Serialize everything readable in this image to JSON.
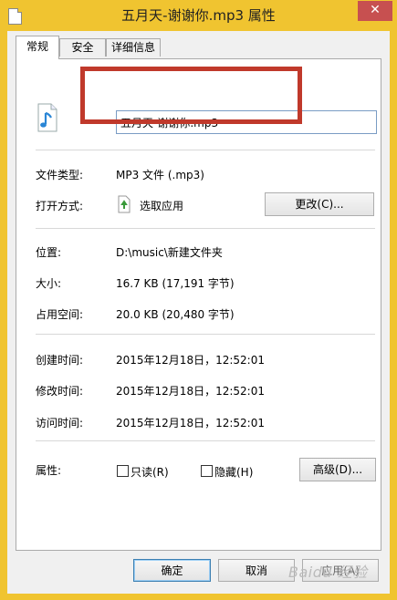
{
  "window": {
    "title": "五月天-谢谢你.mp3 属性",
    "close_glyph": "✕"
  },
  "tabs": [
    {
      "label": "常规",
      "active": true
    },
    {
      "label": "安全",
      "active": false
    },
    {
      "label": "详细信息",
      "active": false
    }
  ],
  "file": {
    "name": "五月天-谢谢你.mp3",
    "icon": "music-note-icon"
  },
  "general": {
    "file_type_label": "文件类型:",
    "file_type_value": "MP3 文件 (.mp3)",
    "open_with_label": "打开方式:",
    "open_with_value": "选取应用",
    "change_button": "更改(C)..."
  },
  "location": {
    "location_label": "位置:",
    "location_value": "D:\\music\\新建文件夹",
    "size_label": "大小:",
    "size_value": "16.7 KB (17,191 字节)",
    "size_on_disk_label": "占用空间:",
    "size_on_disk_value": "20.0 KB (20,480 字节)"
  },
  "times": {
    "created_label": "创建时间:",
    "created_value": "2015年12月18日，12:52:01",
    "modified_label": "修改时间:",
    "modified_value": "2015年12月18日，12:52:01",
    "accessed_label": "访问时间:",
    "accessed_value": "2015年12月18日，12:52:01"
  },
  "attributes": {
    "label": "属性:",
    "readonly_label": "只读(R)",
    "readonly_checked": false,
    "hidden_label": "隐藏(H)",
    "hidden_checked": false,
    "advanced_button": "高级(D)..."
  },
  "footer": {
    "ok": "确定",
    "cancel": "取消",
    "apply": "应用(A)"
  },
  "watermark": "Baidu 经验",
  "colors": {
    "title_bar": "#f0c430",
    "highlight": "#c0392b",
    "close": "#c75050"
  }
}
